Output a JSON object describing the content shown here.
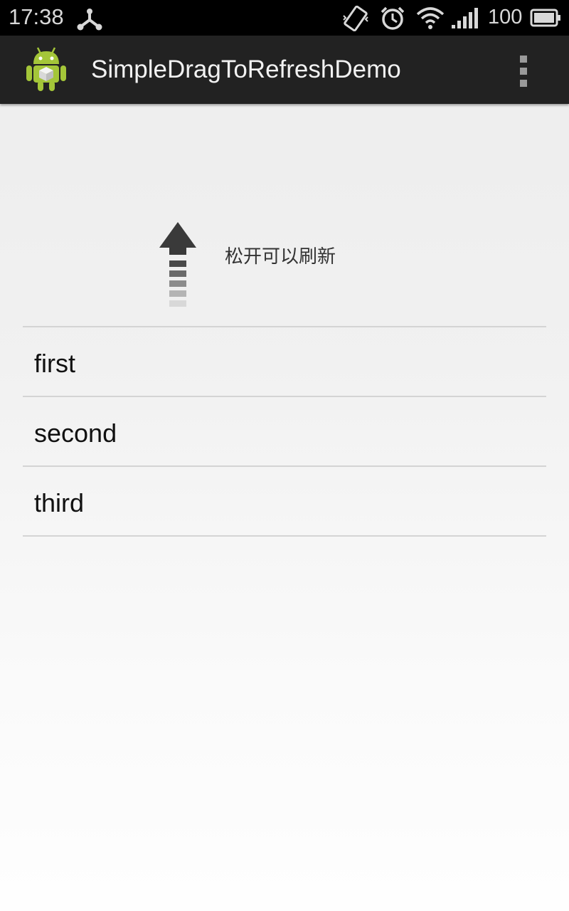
{
  "status_bar": {
    "time": "17:38",
    "battery_level": "100",
    "icons": [
      "usb-icon",
      "vibrate-icon",
      "alarm-icon",
      "wifi-icon",
      "signal-icon",
      "battery-icon"
    ]
  },
  "action_bar": {
    "app_icon": "android-icon",
    "title": "SimpleDragToRefreshDemo",
    "overflow_icon": "overflow-menu-icon"
  },
  "refresh_header": {
    "arrow_icon": "pull-arrow-up-icon",
    "text": "松开可以刷新"
  },
  "list": {
    "items": [
      {
        "label": "first"
      },
      {
        "label": "second"
      },
      {
        "label": "third"
      }
    ]
  },
  "colors": {
    "status_bar_bg": "#000000",
    "action_bar_bg": "#222222",
    "divider": "#d4d4d4",
    "android_green": "#a4c639"
  }
}
